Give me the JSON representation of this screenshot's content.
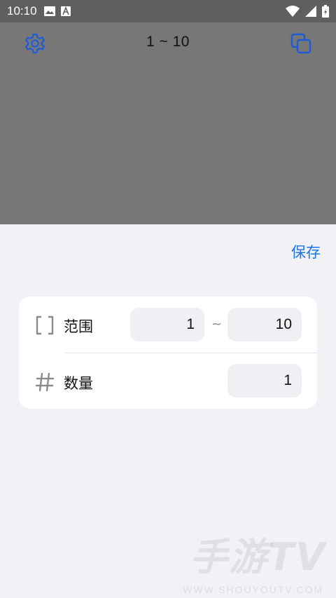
{
  "status_bar": {
    "time": "10:10"
  },
  "header": {
    "range_title": "1 ~ 10"
  },
  "sheet": {
    "save_label": "保存",
    "range_row": {
      "label": "范围",
      "from_value": "1",
      "separator": "~",
      "to_value": "10"
    },
    "count_row": {
      "label": "数量",
      "value": "1"
    }
  },
  "watermark": {
    "main": "手游TV",
    "sub": "WWW.SHOUYOUTV.COM"
  },
  "colors": {
    "accent": "#1a73e8",
    "icon_blue": "#1e5bd8",
    "overlay": "#777777"
  }
}
